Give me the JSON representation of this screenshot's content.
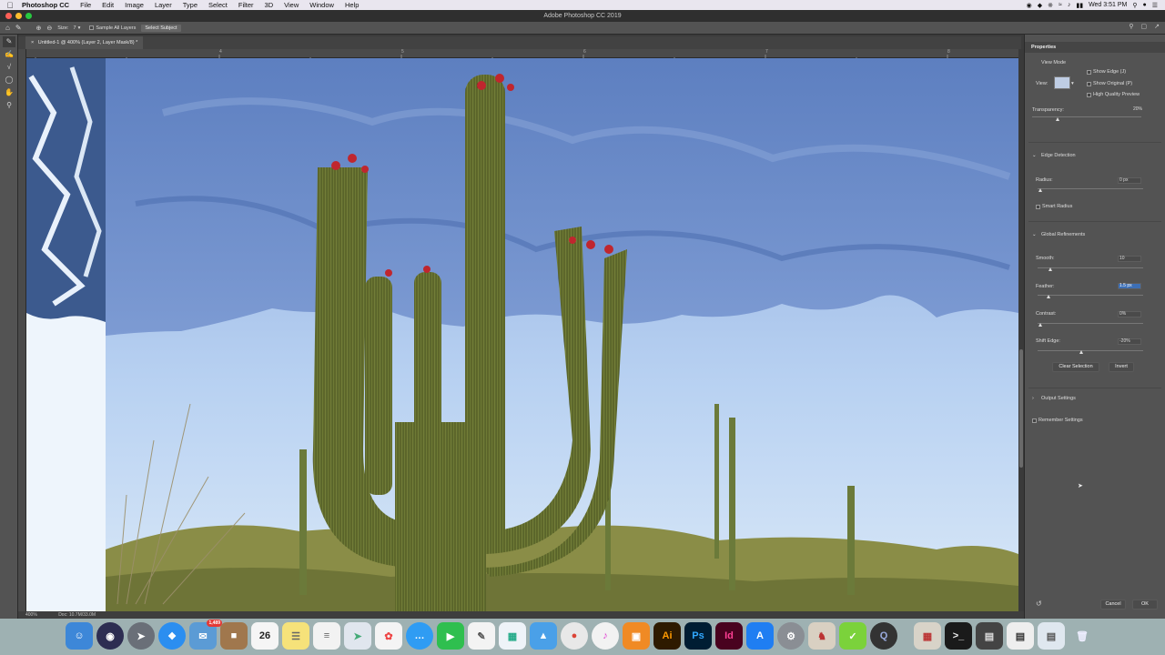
{
  "menubar": {
    "app_name": "Photoshop CC",
    "menus": [
      "File",
      "Edit",
      "Image",
      "Layer",
      "Type",
      "Select",
      "Filter",
      "3D",
      "View",
      "Window",
      "Help"
    ],
    "clock": "Wed 3:51 PM"
  },
  "window": {
    "title": "Adobe Photoshop CC 2019"
  },
  "options": {
    "size_label": "Size:",
    "size_value": "7",
    "sample_all_layers": "Sample All Layers",
    "select_subject": "Select Subject"
  },
  "document": {
    "tab_title": "Untitled-1 @ 400% (Layer 2, Layer Mask/8) *",
    "ruler_ticks": [
      "2",
      "4",
      "5",
      "6",
      "7",
      "8"
    ],
    "zoom": "400%",
    "doc_info": "Doc: 10.7M/33.0M"
  },
  "properties": {
    "panel_title": "Properties",
    "view_mode": {
      "section_label": "View Mode",
      "view_label": "View:",
      "show_edge": "Show Edge (J)",
      "show_original": "Show Original (P)",
      "high_quality_preview": "High Quality Preview"
    },
    "transparency": {
      "label": "Transparency:",
      "value": "20%",
      "level": 0.2
    },
    "edge_detection": {
      "section_label": "Edge Detection",
      "radius_label": "Radius:",
      "radius_value": "0 px",
      "smart_radius": "Smart Radius"
    },
    "global_refinements": {
      "section_label": "Global Refinements",
      "smooth_label": "Smooth:",
      "smooth_value": "10",
      "feather_label": "Feather:",
      "feather_value": "1.5 px",
      "contrast_label": "Contrast:",
      "contrast_value": "0%",
      "shift_edge_label": "Shift Edge:",
      "shift_edge_value": "-20%"
    },
    "clear_selection": "Clear Selection",
    "invert": "Invert",
    "output_settings": "Output Settings",
    "remember_settings": "Remember Settings",
    "cancel": "Cancel",
    "ok": "OK"
  },
  "dock": {
    "mail_badge": "1,489",
    "calendar_day": "26",
    "illustrator": "Ai",
    "photoshop": "Ps",
    "indesign": "Id"
  }
}
